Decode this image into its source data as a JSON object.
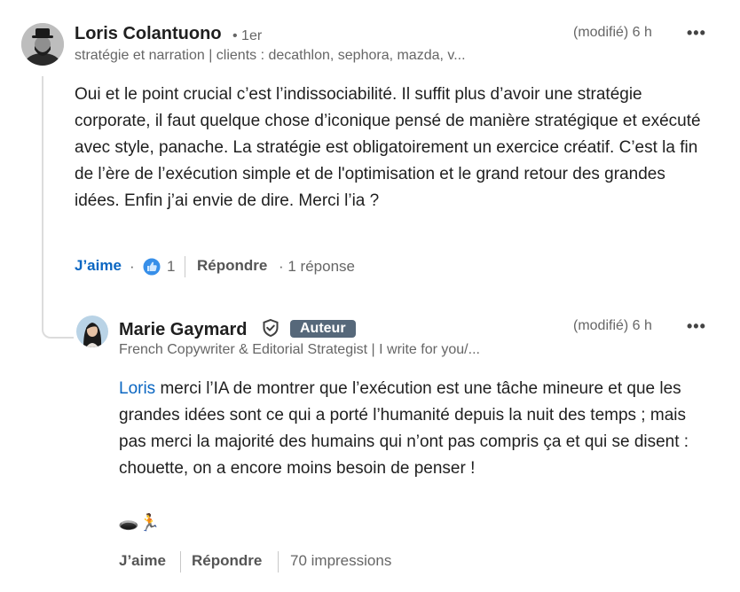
{
  "comment": {
    "author": "Loris Colantuono",
    "degree": "• 1er",
    "headline": "stratégie et narration | clients : decathlon, sephora, mazda, v...",
    "edited": "(modifié) 6 h",
    "more": "•••",
    "text": "Oui et le point crucial c’est l’indissociabilité. Il suffit plus d’avoir une stratégie corporate, il faut quelque chose d’iconique pensé de manière stratégique et exécuté avec style, panache. La stratégie est obligatoirement un exercice créatif. C’est la fin de l’ère de l’exécution simple et de l'optimisation et le grand retour des grandes idées. Enfin j’ai envie de dire. Merci l’ia ?",
    "like_label": "J’aime",
    "dot": "·",
    "reaction_count": "1",
    "reply_label": "Répondre",
    "replies": "· 1 réponse"
  },
  "reply": {
    "author": "Marie Gaymard",
    "badge": "Auteur",
    "headline": "French Copywriter & Editorial Strategist | I write for you/...",
    "edited": "(modifié) 6 h",
    "more": "•••",
    "mention": "Loris",
    "text": " merci l’IA de montrer que l’exécution est une tâche mineure et que les grandes idées sont ce qui a porté l’humanité depuis la nuit des temps ; mais pas merci la majorité des humains qui n’ont pas compris ça et qui se disent : chouette, on a encore moins besoin de penser !",
    "emoji": "🕳️🏃",
    "like_label": "J’aime",
    "reply_label": "Répondre",
    "impressions": "70 impressions"
  },
  "icons": {
    "like": "like-reaction-icon",
    "verified": "verified-shield-icon"
  },
  "colors": {
    "link": "#0a66c2",
    "badge": "#56687a",
    "text": "#1f1f1f",
    "muted": "#666666"
  }
}
